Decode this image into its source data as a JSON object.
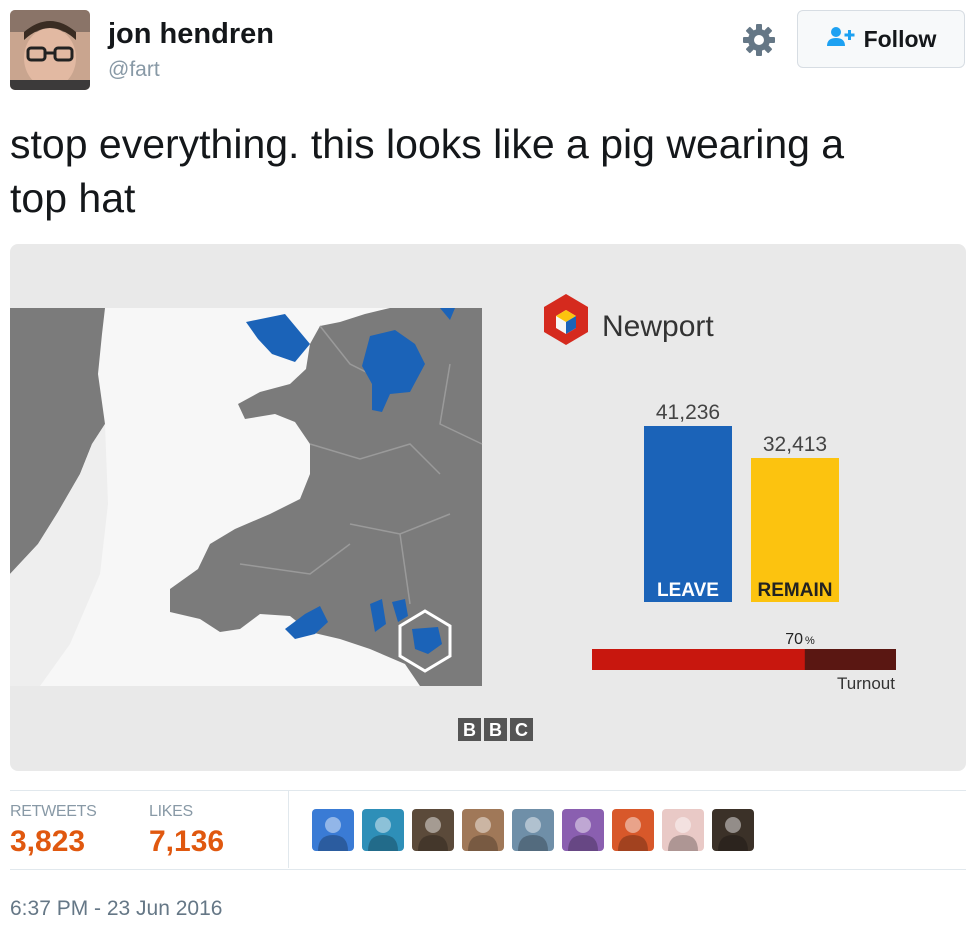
{
  "user": {
    "name": "jon hendren",
    "handle": "@fart"
  },
  "follow_button": {
    "label": "Follow"
  },
  "tweet": {
    "text_line1": "stop everything. this looks like a pig wearing a",
    "text_line2": "top hat"
  },
  "graphic": {
    "constituency": "Newport",
    "leave_value": "41,236",
    "remain_value": "32,413",
    "leave_label": "LEAVE",
    "remain_label": "REMAIN",
    "turnout_percent": "70",
    "turnout_suffix": "%",
    "turnout_label": "Turnout",
    "turnout_fraction": 0.7,
    "broadcaster_letters": [
      "B",
      "B",
      "C"
    ],
    "colors": {
      "leave": "#1b63b8",
      "remain": "#fcc30f",
      "turnout_fill": "#c8170e",
      "turnout_track": "#5a1712",
      "map_grey": "#7b7b7b"
    }
  },
  "stats": {
    "retweets_label": "RETWEETS",
    "retweets_value": "3,823",
    "likes_label": "LIKES",
    "likes_value": "7,136"
  },
  "likers": [
    {
      "icon": "cartoon-avatar",
      "color": "#3a7bd5"
    },
    {
      "icon": "person-avatar",
      "color": "#2e8fb8"
    },
    {
      "icon": "dog-avatar",
      "color": "#5b4a3a"
    },
    {
      "icon": "person-avatar",
      "color": "#a07858"
    },
    {
      "icon": "person-avatar",
      "color": "#6f8fa8"
    },
    {
      "icon": "cartoon-avatar",
      "color": "#8a5fb0"
    },
    {
      "icon": "food-avatar",
      "color": "#d8582a"
    },
    {
      "icon": "drawing-avatar",
      "color": "#e9c9c6"
    },
    {
      "icon": "group-avatar",
      "color": "#3b3128"
    }
  ],
  "timestamp": "6:37 PM - 23 Jun 2016"
}
